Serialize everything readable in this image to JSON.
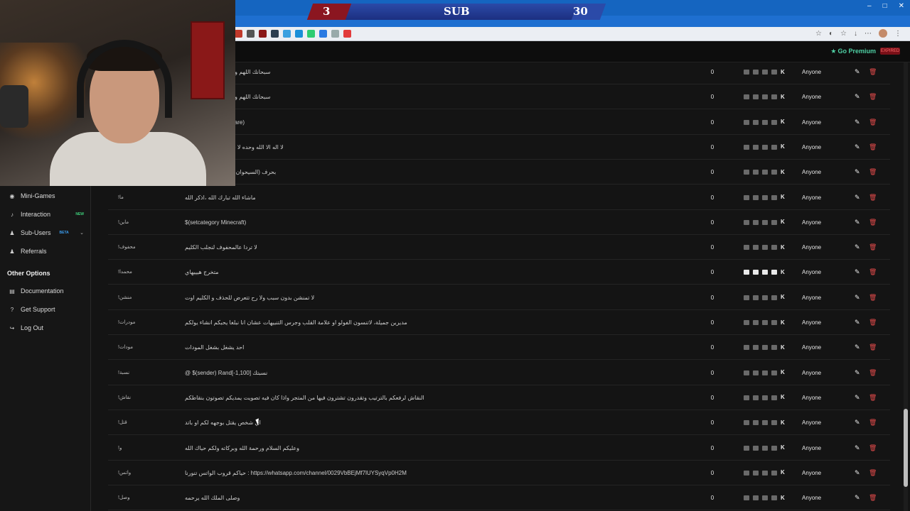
{
  "score": {
    "left": "3",
    "label": "SUB",
    "right": "30"
  },
  "header": {
    "premium_label": "Go Premium",
    "premium_tag": "EXPIRED"
  },
  "window_controls": [
    "–",
    "□",
    "✕"
  ],
  "sidebar": {
    "items": [
      {
        "label": "Mini-Games",
        "icon": "gamepad-icon",
        "badge": ""
      },
      {
        "label": "Interaction",
        "icon": "music-note-icon",
        "badge": "NEW"
      },
      {
        "label": "Sub-Users",
        "icon": "users-icon",
        "badge": "BETA"
      },
      {
        "label": "Referrals",
        "icon": "referrals-icon",
        "badge": ""
      }
    ],
    "section_title": "Other Options",
    "other_items": [
      {
        "label": "Documentation",
        "icon": "document-icon"
      },
      {
        "label": "Get Support",
        "icon": "help-icon"
      },
      {
        "label": "Log Out",
        "icon": "logout-icon"
      }
    ]
  },
  "rows": [
    {
      "command": "",
      "response": "سبحانك اللهم وبحمدك اشهد ان لا إله",
      "count": "0",
      "permission": "Anyone",
      "active": false
    },
    {
      "command": "",
      "response": "سبحانك اللهم وبحمدك اشهد ان لا إله",
      "count": "0",
      "permission": "Anyone",
      "active": false
    },
    {
      "command": "",
      "response": "f Duty: Modern warfare)",
      "count": "0",
      "permission": "Anyone",
      "active": false
    },
    {
      "command": "",
      "response": "لا اله الا الله وحده لا شريك له له الملك وله",
      "count": "0",
      "permission": "Anyone",
      "active": false
    },
    {
      "command": "",
      "response": "RandomList[...] بحرف (السيحوان )كله",
      "count": "0",
      "permission": "Anyone",
      "active": false
    },
    {
      "command": "!ما",
      "response": "ماشاء الله تبارك الله ،اذكر الله",
      "count": "0",
      "permission": "Anyone",
      "active": false
    },
    {
      "command": "!ماين",
      "response": "$(setcategory Minecraft)",
      "count": "0",
      "permission": "Anyone",
      "active": false
    },
    {
      "command": "!محفوف",
      "response": "لا تردا عالمحفوف لنجلب الكليم",
      "count": "0",
      "permission": "Anyone",
      "active": false
    },
    {
      "command": "!محمدا",
      "response": "متخرج هيييهاي",
      "count": "0",
      "permission": "Anyone",
      "active": true
    },
    {
      "command": "!منشن",
      "response": "لا تمنشن بدون سبب ولا رح تتعرض للحذف و الكليم اوت",
      "count": "0",
      "permission": "Anyone",
      "active": false
    },
    {
      "command": "!مودرات",
      "response": "مديرين جميلة، لاتنسون الفولو او علامة القلب وجرس التنبيهات عشان انا نبلغا يحبكم انشاء يولكم",
      "count": "0",
      "permission": "Anyone",
      "active": false
    },
    {
      "command": "!مودات",
      "response": "احد يشغل بشغل المودات",
      "count": "0",
      "permission": "Anyone",
      "active": false
    },
    {
      "command": "!نسبة",
      "response": "@ $(sender) Rand[-1,100] نسبتك",
      "count": "0",
      "permission": "Anyone",
      "active": false
    },
    {
      "command": "!نقاش",
      "response": "النقاش لرفعكم بالترتيب وتقدرون تشترون فيها من المتجر واذا كان فيه تصويت يمديكم تصوتون بنقاطكم",
      "count": "0",
      "permission": "Anyone",
      "active": false
    },
    {
      "command": "!قتل",
      "response": "اي شخص يقتل بوجهه لكم او باتد",
      "count": "0",
      "permission": "Anyone",
      "active": false
    },
    {
      "command": "!و",
      "response": "وعليكم السلام ورحمة الله وبركاته ولكم حياك الله",
      "count": "0",
      "permission": "Anyone",
      "active": false
    },
    {
      "command": "!واتس",
      "response": "حياكم قروب الواتس تنورنا : https://whatsapp.com/channel/0029VbBEjMf7lUYSyqVp0H2M",
      "count": "0",
      "permission": "Anyone",
      "active": false
    },
    {
      "command": "!وصل",
      "response": "وصلى الملك الله يرحمه",
      "count": "0",
      "permission": "Anyone",
      "active": false
    }
  ],
  "colors": {
    "accent": "#4fd1a5",
    "danger": "#e34b4b",
    "browser_blue": "#1565c0"
  }
}
